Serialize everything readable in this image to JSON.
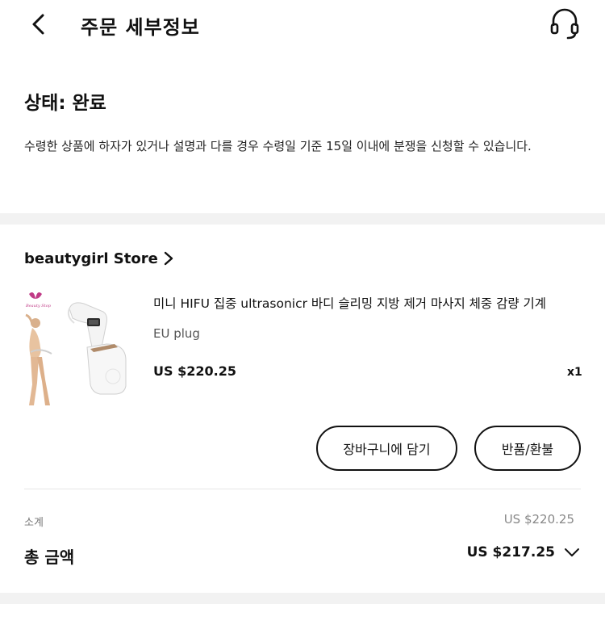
{
  "header": {
    "title": "주문 세부정보",
    "back_icon": "back-arrow-icon",
    "support_icon": "headset-icon"
  },
  "status": {
    "title": "상태: 완료",
    "description": "수령한 상품에 하자가 있거나 설명과 다를 경우 수령일 기준 15일 이내에 분쟁을 신청할 수 있습니다."
  },
  "store": {
    "name": "beautygirl Store",
    "chevron_icon": "chevron-right-icon"
  },
  "product": {
    "name": "미니 HIFU 집중 ultrasonicr 바디 슬리밍 지방 제거 마사지 체중 감량 기계",
    "variant": "EU plug",
    "price": "US $220.25",
    "quantity": "x1",
    "image_logo_text": "Beauty Stop"
  },
  "actions": {
    "add_to_cart": "장바구니에 담기",
    "return_refund": "반품/환불"
  },
  "summary": {
    "subtotal_label": "소계",
    "subtotal_value": "US $220.25",
    "total_label": "총 금액",
    "total_value": "US $217.25",
    "expand_icon": "chevron-down-icon"
  },
  "colors": {
    "background": "#ffffff",
    "band": "#f2f2f2",
    "text": "#111111",
    "muted": "#888888"
  }
}
